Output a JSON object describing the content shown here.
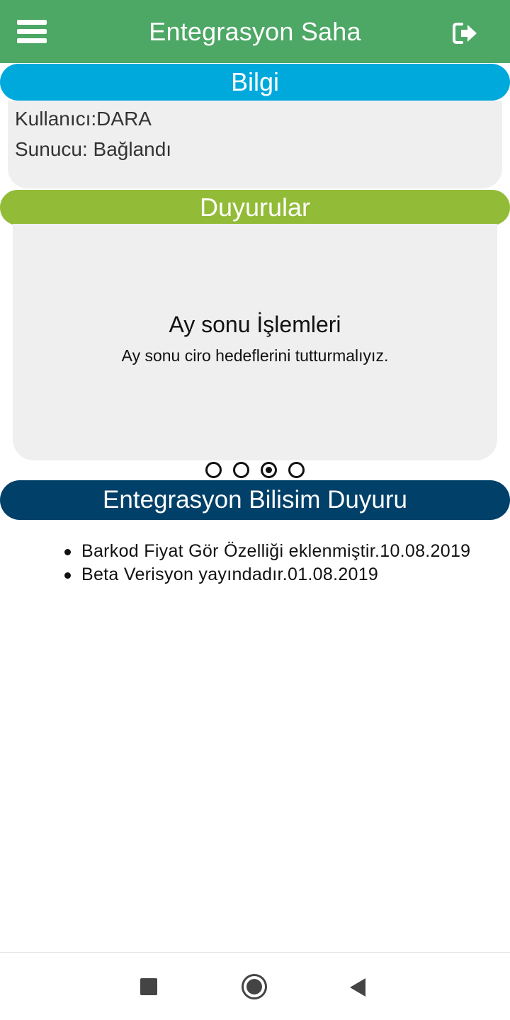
{
  "app_bar": {
    "title": "Entegrasyon Saha",
    "menu_icon": "hamburger-menu-icon",
    "logout_icon": "logout-icon",
    "color": "#4da765"
  },
  "info": {
    "header": "Bilgi",
    "user_line": "Kullanıcı:DARA",
    "server_line": "Sunucu: Bağlandı",
    "color": "#00a9dc"
  },
  "announcements": {
    "header": "Duyurular",
    "color": "#92bb37",
    "slide_title": "Ay sonu İşlemleri",
    "slide_text": "Ay sonu ciro hedeflerini tutturmalıyız.",
    "page_count": 4,
    "active_page": 3
  },
  "company_news": {
    "header": "Entegrasyon Bilisim Duyuru",
    "color": "#004069",
    "items": [
      "Barkod Fiyat Gör Özelliği eklenmiştir.10.08.2019",
      "Beta Verisyon yayındadır.01.08.2019"
    ]
  },
  "nav": {
    "recent_icon": "recent-apps-icon",
    "home_icon": "home-icon",
    "back_icon": "back-icon"
  }
}
